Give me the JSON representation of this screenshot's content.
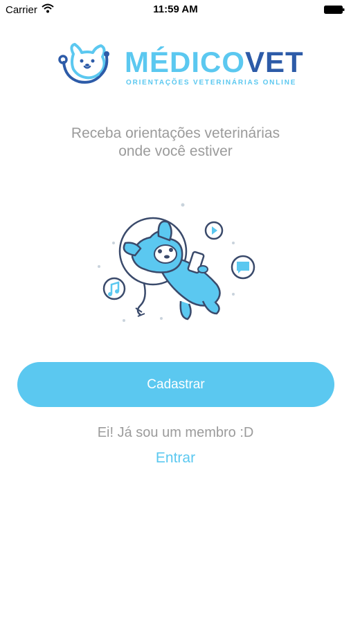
{
  "status_bar": {
    "carrier": "Carrier",
    "time": "11:59 AM"
  },
  "logo": {
    "name_part1": "MÉDICO",
    "name_part2": "VET",
    "tagline": "ORIENTAÇÕES VETERINÁRIAS ONLINE"
  },
  "intro": {
    "line1": "Receba orientações veterinárias",
    "line2": "onde você estiver"
  },
  "actions": {
    "signup_label": "Cadastrar",
    "member_text": "Ei! Já sou um membro :D",
    "login_label": "Entrar"
  },
  "colors": {
    "accent": "#5bc8f0",
    "brand_dark": "#2d5ba8",
    "muted_text": "#9b9b9b"
  }
}
